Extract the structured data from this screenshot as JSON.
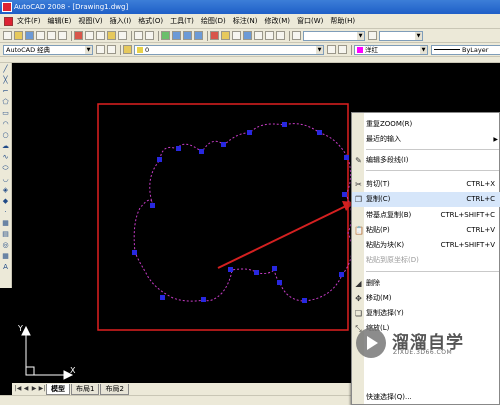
{
  "window": {
    "title": "AutoCAD 2008 - [Drawing1.dwg]"
  },
  "menu": [
    "文件(F)",
    "编辑(E)",
    "视图(V)",
    "插入(I)",
    "格式(O)",
    "工具(T)",
    "绘图(D)",
    "标注(N)",
    "修改(M)",
    "窗口(W)",
    "帮助(H)"
  ],
  "toolbar": {
    "workspace": "AutoCAD 经典",
    "layer": "0",
    "color": "洋红",
    "linetype": "ByLayer"
  },
  "tabs": [
    "模型",
    "布局1",
    "布局2"
  ],
  "context_menu": {
    "items": [
      {
        "label": "重复ZOOM(R)",
        "shortcut": "",
        "icon": "",
        "disabled": false,
        "submenu": false
      },
      {
        "label": "最近的输入",
        "shortcut": "",
        "icon": "",
        "disabled": false,
        "submenu": true
      },
      {
        "label": "编辑多段线(I)",
        "shortcut": "",
        "icon": "pen-icon",
        "disabled": false,
        "submenu": false
      },
      {
        "label": "剪切(T)",
        "shortcut": "CTRL+X",
        "icon": "scissors-icon",
        "disabled": false,
        "submenu": false
      },
      {
        "label": "复制(C)",
        "shortcut": "CTRL+C",
        "icon": "copy-icon",
        "disabled": false,
        "submenu": false
      },
      {
        "label": "带基点复制(B)",
        "shortcut": "CTRL+SHIFT+C",
        "icon": "",
        "disabled": false,
        "submenu": false
      },
      {
        "label": "粘贴(P)",
        "shortcut": "CTRL+V",
        "icon": "paste-icon",
        "disabled": false,
        "submenu": false
      },
      {
        "label": "粘贴为块(K)",
        "shortcut": "CTRL+SHIFT+V",
        "icon": "",
        "disabled": false,
        "submenu": false
      },
      {
        "label": "粘贴到原坐标(D)",
        "shortcut": "",
        "icon": "",
        "disabled": true,
        "submenu": false
      },
      {
        "label": "删除",
        "shortcut": "",
        "icon": "eraser-icon",
        "disabled": false,
        "submenu": false
      },
      {
        "label": "移动(M)",
        "shortcut": "",
        "icon": "move-icon",
        "disabled": false,
        "submenu": false
      },
      {
        "label": "复制选择(Y)",
        "shortcut": "",
        "icon": "copy-select-icon",
        "disabled": false,
        "submenu": false
      },
      {
        "label": "缩放(L)",
        "shortcut": "",
        "icon": "scale-icon",
        "disabled": false,
        "submenu": false
      },
      {
        "label": "快速选择(Q)...",
        "shortcut": "",
        "icon": "",
        "disabled": false,
        "submenu": false
      }
    ]
  },
  "watermark": {
    "name": "溜溜自学",
    "url": "ZIXUE.3D66.COM"
  },
  "colors": {
    "selection_frame": "#e02020",
    "grip": "#2828e0",
    "curve": "#c83cc8",
    "arrow": "#d42020"
  }
}
